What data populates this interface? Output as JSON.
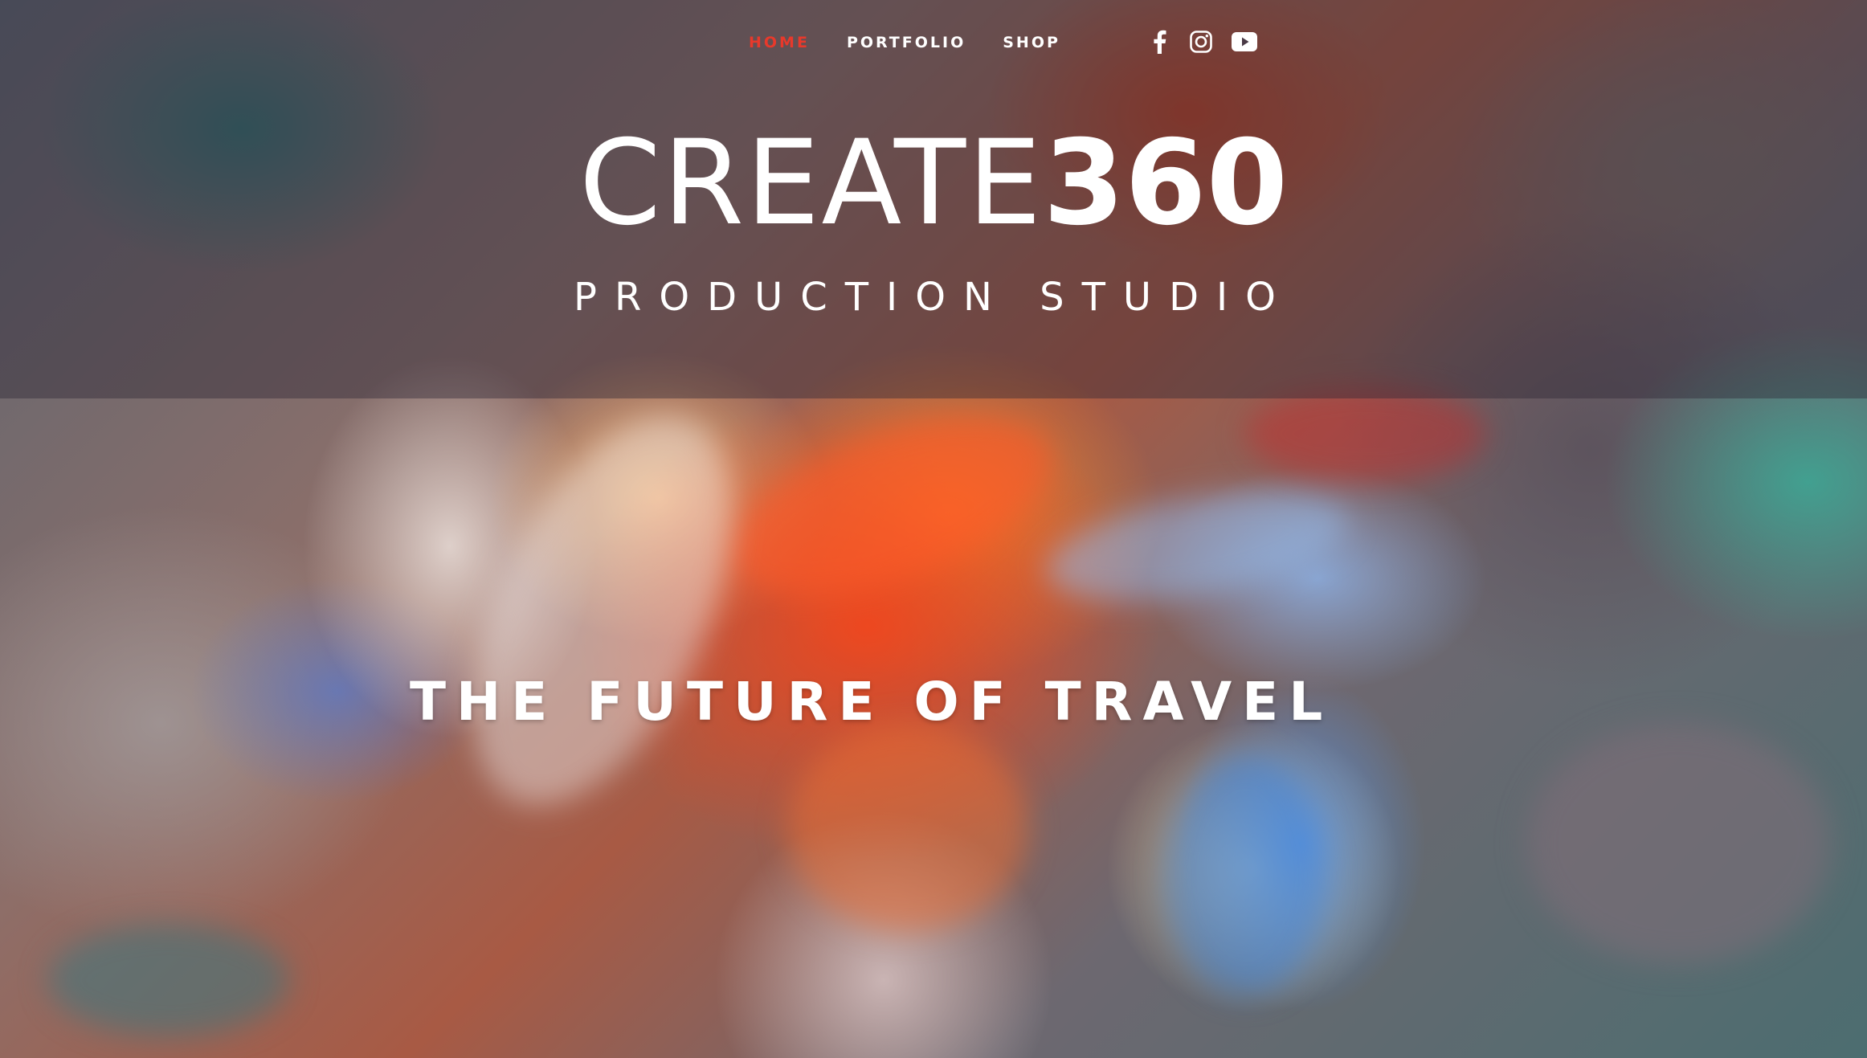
{
  "nav": {
    "items": [
      {
        "label": "HOME",
        "active": true
      },
      {
        "label": "PORTFOLIO",
        "active": false
      },
      {
        "label": "SHOP",
        "active": false
      }
    ],
    "active_color": "#e8392b"
  },
  "social": {
    "icons": [
      "facebook-icon",
      "instagram-icon",
      "youtube-icon"
    ]
  },
  "brand": {
    "name_light": "CREATE",
    "name_bold": "360",
    "tagline": "PRODUCTION STUDIO"
  },
  "hero": {
    "headline": "THE FUTURE OF TRAVEL"
  }
}
